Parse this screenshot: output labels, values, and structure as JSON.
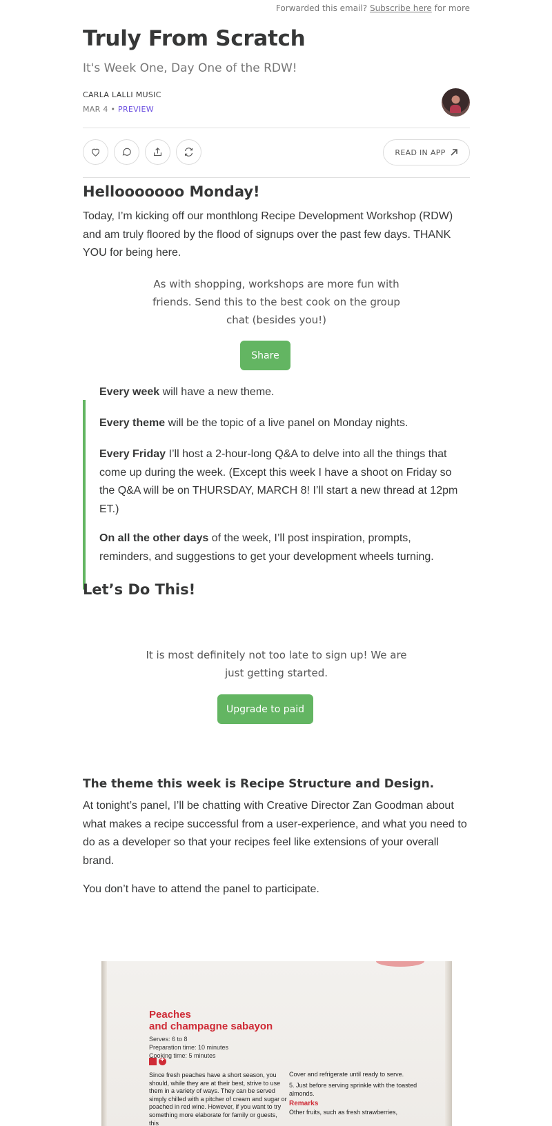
{
  "forward": {
    "prefix": "Forwarded this email?",
    "link": "Subscribe here",
    "suffix": "for more"
  },
  "post": {
    "title": "Truly From Scratch",
    "subtitle": "It's Week One, Day One of the RDW!",
    "author": "CARLA LALLI MUSIC",
    "date": "MAR 4",
    "separator": "•",
    "preview_label": "PREVIEW"
  },
  "actions": {
    "read_in_app": "READ IN APP"
  },
  "section1": {
    "heading": "Hellooooooo Monday!",
    "intro": "Today, I’m kicking off our monthlong Recipe Development Workshop (RDW) and am truly floored by the flood of signups over the past few days. THANK YOU for being here."
  },
  "share_cta": {
    "text": "As with shopping, workshops are more fun with friends. Send this to the best cook on the group chat (besides you!)",
    "button": "Share"
  },
  "quote": {
    "items": [
      {
        "bold": "Every week",
        "rest": " will have a new theme."
      },
      {
        "bold": "Every theme",
        "rest": " will be the topic of a live panel on Monday nights."
      },
      {
        "bold": "Every Friday",
        "rest": " I’ll host a 2-hour-long Q&A to delve into all the things that come up during the week. (Except this week I have a shoot on Friday so the Q&A will be on THURSDAY, MARCH 8! I’ll start a new thread at 12pm ET.)"
      },
      {
        "bold": "On all the other days",
        "rest": " of the week, I’ll post inspiration, prompts, reminders, and suggestions to get your development wheels turning."
      }
    ]
  },
  "section2": {
    "heading": "Let’s Do This!"
  },
  "upgrade_cta": {
    "text": "It is most definitely not too late to sign up! We are just getting started.",
    "button": "Upgrade to paid"
  },
  "section3": {
    "heading": "The theme this week is Recipe Structure and Design.",
    "para1": "At tonight’s panel, I’ll be chatting with Creative Director Zan Goodman about what makes a recipe successful from a user-experience, and what you need to do as a developer so that your recipes feel like extensions of your overall brand.",
    "para2": "You don’t have to attend the panel to participate."
  },
  "recipe_photo": {
    "title_line1": "Peaches",
    "title_line2": "and champagne sabayon",
    "serves": "Serves: 6 to 8",
    "prep": "Preparation time: 10 minutes",
    "cook": "Cooking time: 5 minutes",
    "col1": "Since fresh peaches have a short season, you should, while they are at their best, strive to use them in a variety of ways. They can be served simply chilled with a pitcher of cream and sugar or poached in red wine. However, if you want to try something more elaborate for family or guests, this",
    "col2_line1": "Cover and refrigerate until ready to serve.",
    "col2_line2": "5. Just before serving sprinkle with the toasted almonds.",
    "remarks": "Remarks",
    "remarks_text": "Other fruits, such as fresh strawberries,"
  }
}
